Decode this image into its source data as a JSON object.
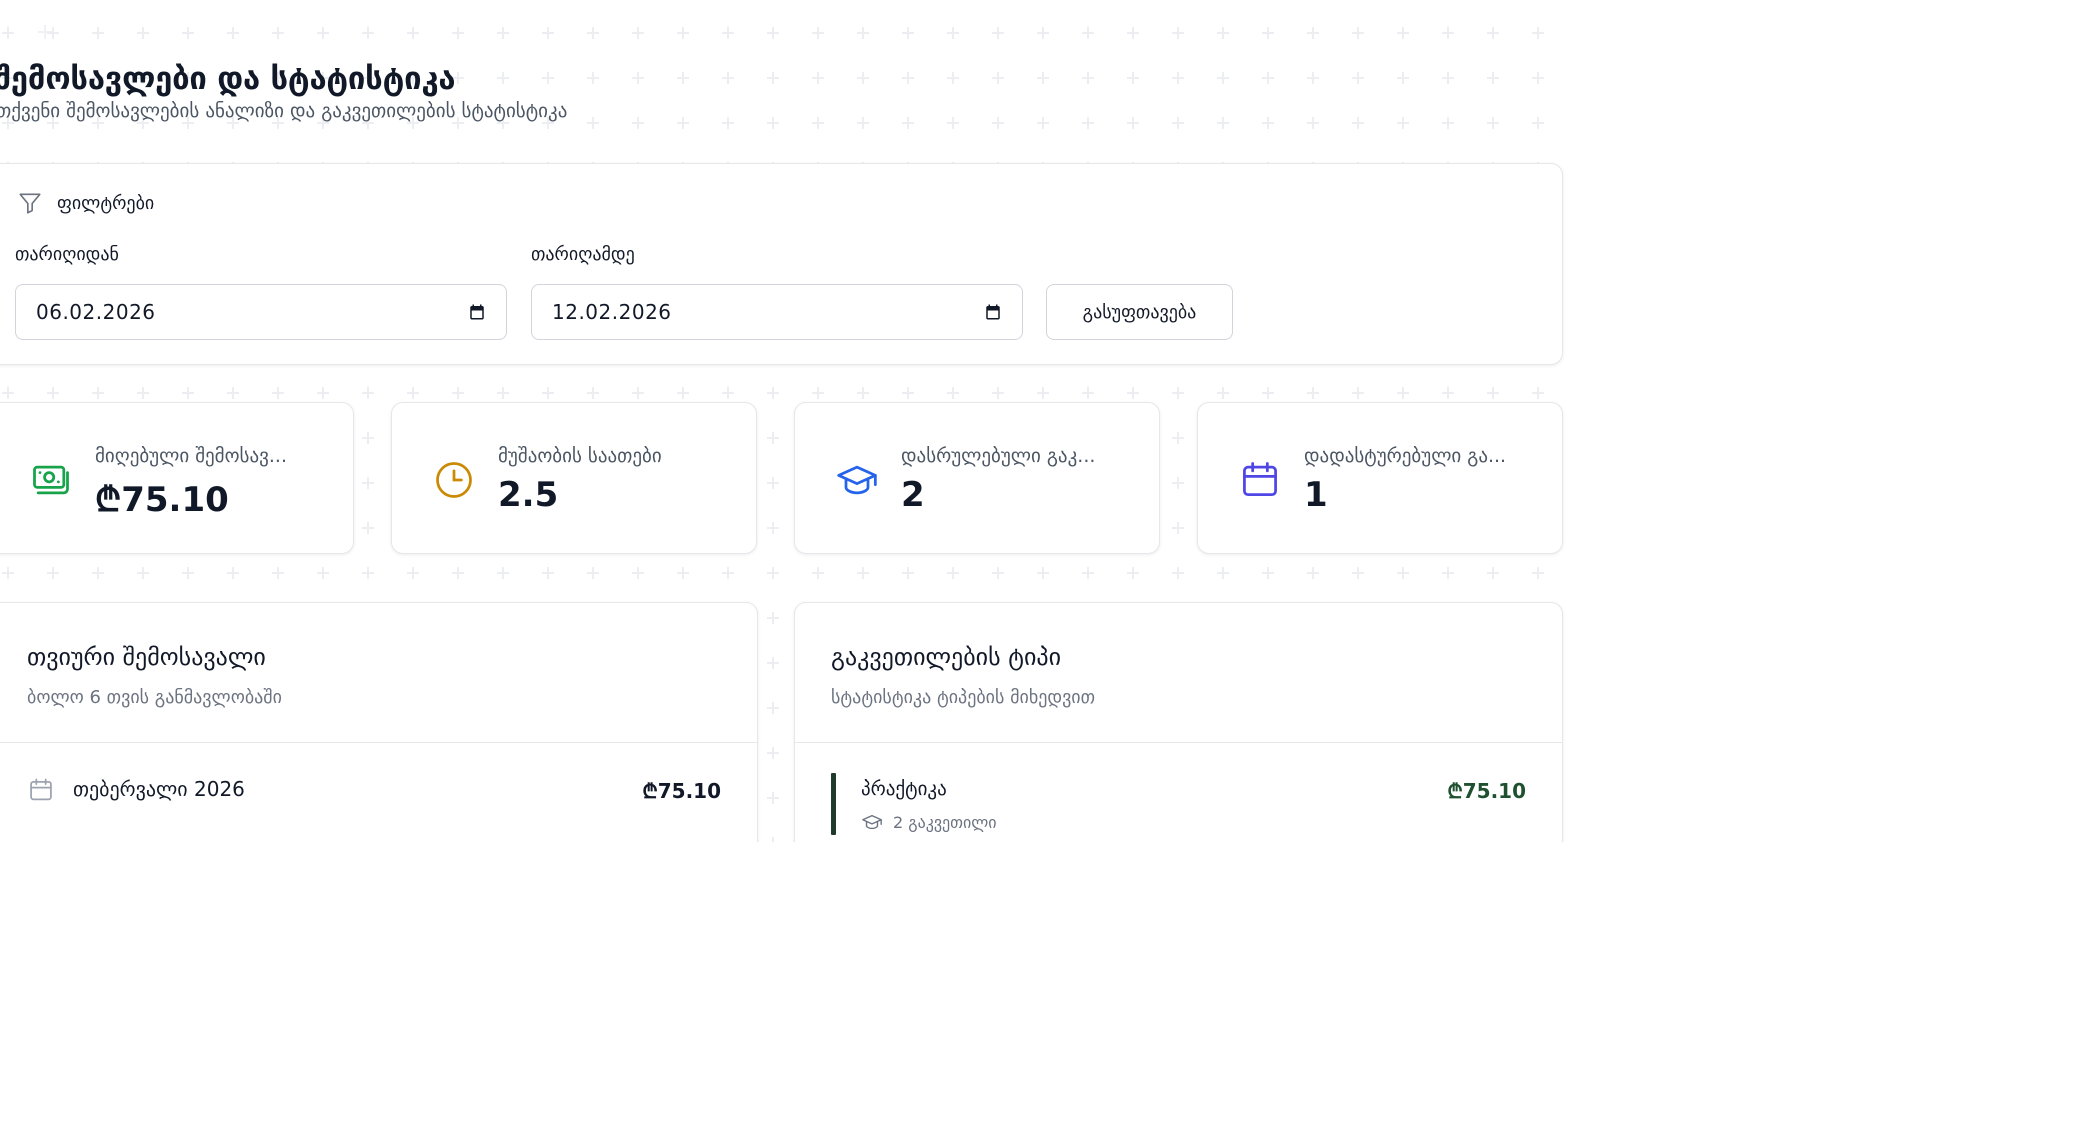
{
  "header": {
    "title": "შემოსავლები და სტატისტიკა",
    "subtitle": "თქვენი შემოსავლების ანალიზი და გაკვეთილების სტატისტიკა"
  },
  "filters": {
    "title": "ფილტრები",
    "from_label": "თარიღიდან",
    "from_value": "06.02.2026",
    "to_label": "თარიღამდე",
    "to_value": "12.02.2026",
    "clear_label": "გასუფთავება"
  },
  "stats": [
    {
      "label": "მიღებული შემოსავ...",
      "value": "₾75.10",
      "icon": "money-icon",
      "color": "#16a34a"
    },
    {
      "label": "მუშაობის საათები",
      "value": "2.5",
      "icon": "clock-icon",
      "color": "#ca8a04"
    },
    {
      "label": "დასრულებული გაკ...",
      "value": "2",
      "icon": "graduation-cap-icon",
      "color": "#2563eb"
    },
    {
      "label": "დადასტურებული გა...",
      "value": "1",
      "icon": "calendar-icon",
      "color": "#4f46e5"
    }
  ],
  "monthly": {
    "title": "თვიური შემოსავალი",
    "subtitle": "ბოლო 6 თვის განმავლობაში",
    "rows": [
      {
        "month": "თებერვალი 2026",
        "amount": "₾75.10"
      }
    ]
  },
  "lesson_types": {
    "title": "გაკვეთილების ტიპი",
    "subtitle": "სტატისტიკა ტიპების მიხედვით",
    "rows": [
      {
        "name": "პრაქტიკა",
        "count": "2 გაკვეთილი",
        "amount": "₾75.10"
      }
    ]
  }
}
